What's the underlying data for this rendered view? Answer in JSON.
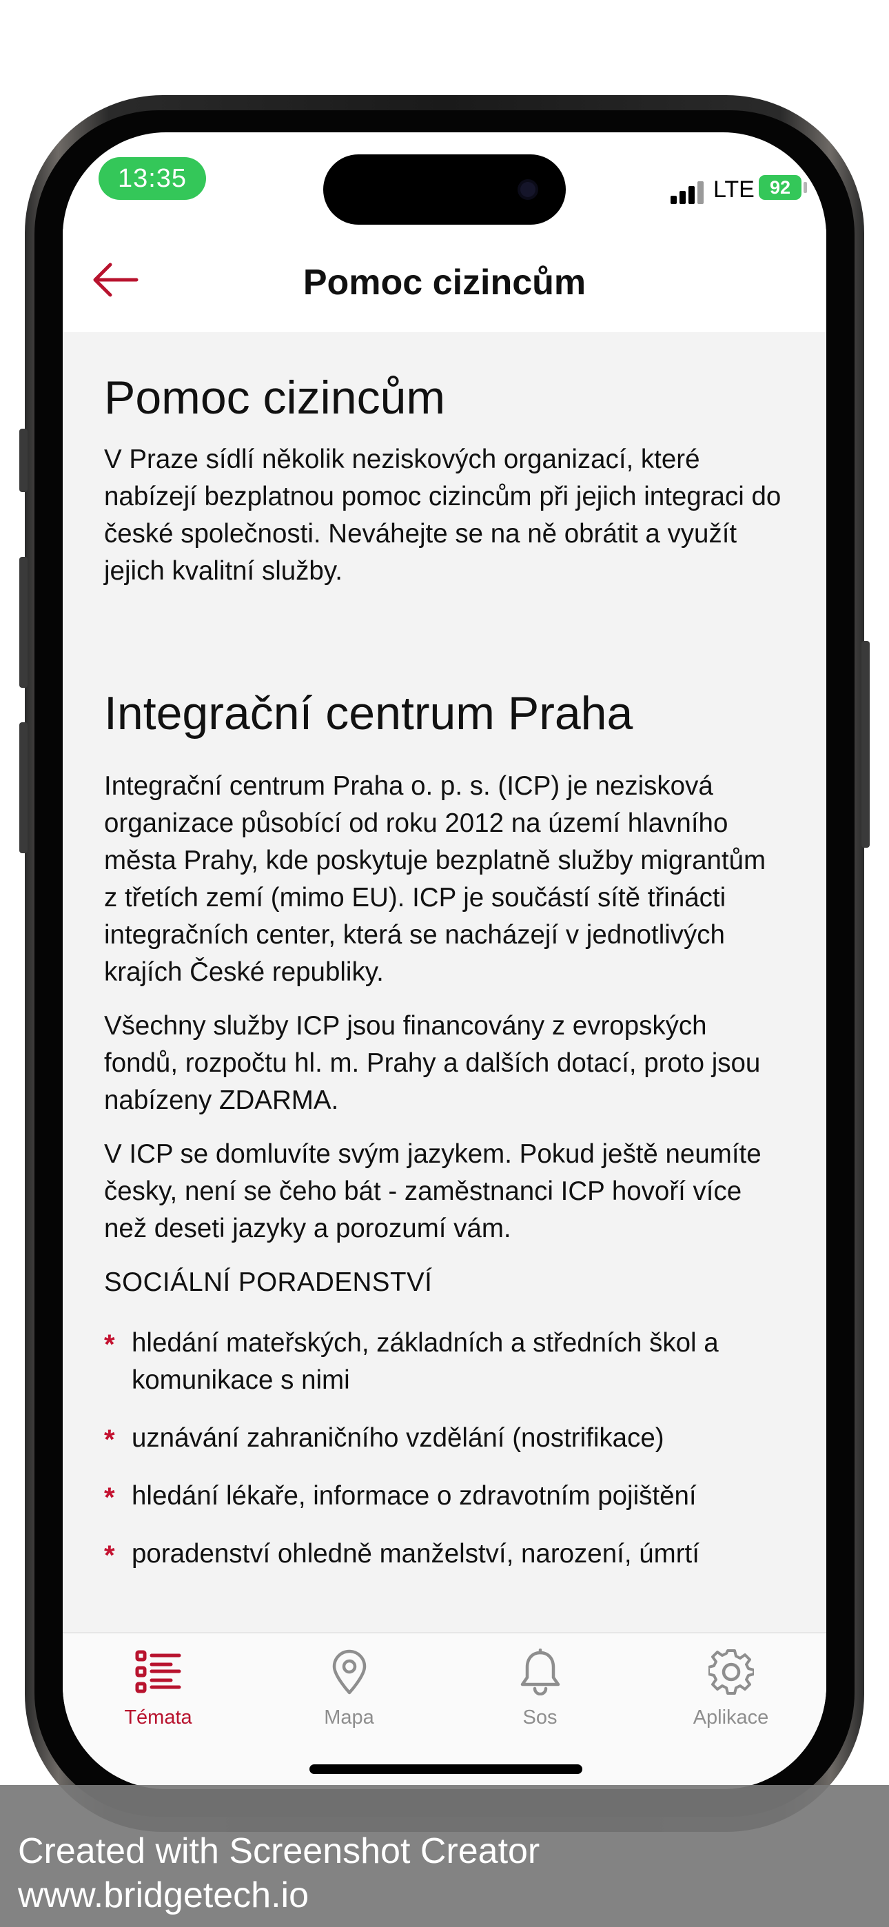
{
  "status_bar": {
    "time": "13:35",
    "network": "LTE",
    "battery": "92"
  },
  "header": {
    "title": "Pomoc cizincům",
    "back_icon": "arrow-left-icon",
    "accent_color": "#b8132e"
  },
  "content": {
    "heading": "Pomoc cizincům",
    "intro": "V Praze sídlí několik neziskových organizací, které nabízejí bezplatnou pomoc cizincům při jejich integraci do české společnosti. Neváhejte se na ně obrátit a využít jejich kvalitní služby.",
    "org_heading": "Integrační centrum Praha",
    "paragraphs": [
      "Integrační centrum Praha o. p. s. (ICP)  je nezisková organizace působící od roku 2012 na území hlavního města Prahy, kde poskytuje bezplatně služby migrantům z třetích zemí (mimo EU). ICP je součástí sítě třinácti integračních center, která se nacházejí v jednotlivých krajích České republiky.",
      "Všechny služby ICP jsou financovány z evropských fondů, rozpočtu hl. m. Prahy a dalších dotací, proto jsou nabízeny ZDARMA.",
      "V ICP se domluvíte svým jazykem. Pokud ještě neumíte česky, není se čeho bát - zaměstnanci ICP hovoří více než deseti jazyky a porozumí vám."
    ],
    "section_title": "SOCIÁLNÍ PORADENSTVÍ",
    "bullet_marker": "*",
    "bullets": [
      "hledání mateřských, základních a středních škol a komunikace s nimi",
      "uznávání zahraničního vzdělání (nostrifikace)",
      "hledání lékaře, informace o zdravotním pojištění",
      "poradenství ohledně manželství, narození, úmrtí"
    ]
  },
  "tabbar": {
    "tabs": [
      {
        "label": "Témata",
        "icon": "list-icon",
        "active": true
      },
      {
        "label": "Mapa",
        "icon": "map-pin-icon",
        "active": false
      },
      {
        "label": "Sos",
        "icon": "bell-icon",
        "active": false
      },
      {
        "label": "Aplikace",
        "icon": "gear-icon",
        "active": false
      }
    ]
  },
  "watermark": {
    "line1": "Created with Screenshot Creator",
    "line2": "www.bridgetech.io"
  }
}
